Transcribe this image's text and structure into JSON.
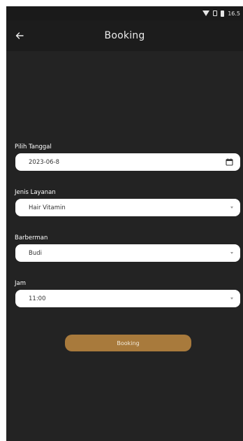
{
  "status_bar": {
    "time": "16.5",
    "wifi_icon": "wifi-icon",
    "sim_icon": "sim-icon",
    "battery_icon": "battery-icon"
  },
  "app_bar": {
    "title": "Booking",
    "back_icon": "arrow-left-icon"
  },
  "form": {
    "date": {
      "label": "Pilih Tanggal",
      "value": "2023-06-8",
      "icon": "calendar-icon"
    },
    "service": {
      "label": "Jenis Layanan",
      "value": "Hair Vitamin",
      "icon": "chevron-down-icon"
    },
    "barberman": {
      "label": "Barberman",
      "value": "Budi",
      "icon": "chevron-down-icon"
    },
    "time": {
      "label": "Jam",
      "value": "11:00",
      "icon": "chevron-down-icon"
    }
  },
  "submit_button": {
    "label": "Booking",
    "color": "#a87a3c"
  },
  "colors": {
    "background": "#232323",
    "app_bar": "#1c1c1c",
    "field": "#ffffff",
    "accent": "#a87a3c"
  }
}
